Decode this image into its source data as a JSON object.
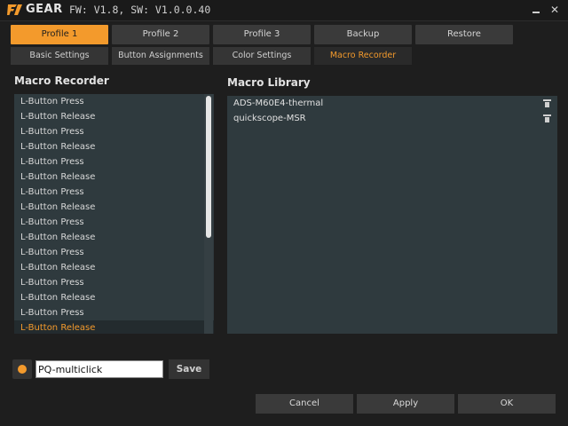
{
  "window": {
    "brand": "GEAR",
    "firmware_text": "FW: V1.8, SW: V1.0.0.40",
    "minimize_label": "_",
    "close_label": "✕"
  },
  "profile_tabs": [
    "Profile 1",
    "Profile 2",
    "Profile 3",
    "Backup",
    "Restore"
  ],
  "sub_tabs": [
    "Basic Settings",
    "Button Assignments",
    "Color Settings",
    "Macro Recorder"
  ],
  "active_profile_tab": "Profile 1",
  "active_sub_tab": "Macro Recorder",
  "macro_recorder": {
    "title": "Macro Recorder",
    "events": [
      "L-Button Press",
      "L-Button Release",
      "L-Button Press",
      "L-Button Release",
      "L-Button Press",
      "L-Button Release",
      "L-Button Press",
      "L-Button Release",
      "L-Button Press",
      "L-Button Release",
      "L-Button Press",
      "L-Button Release",
      "L-Button Press",
      "L-Button Release",
      "L-Button Press",
      "L-Button Release"
    ],
    "selected_index": 15
  },
  "macro_library": {
    "title": "Macro Library",
    "items": [
      "ADS-M60E4-thermal",
      "quickscope-MSR"
    ]
  },
  "macro_name": {
    "value": "PQ-multiclick",
    "save_label": "Save"
  },
  "footer": {
    "cancel_label": "Cancel",
    "apply_label": "Apply",
    "ok_label": "OK"
  },
  "colors": {
    "accent": "#f39a2c",
    "panel": "#2f3a3e",
    "background": "#1e1e1e"
  },
  "icons": {
    "logo": "fnatic-logo-icon",
    "delete": "trash-icon",
    "record": "record-icon"
  }
}
